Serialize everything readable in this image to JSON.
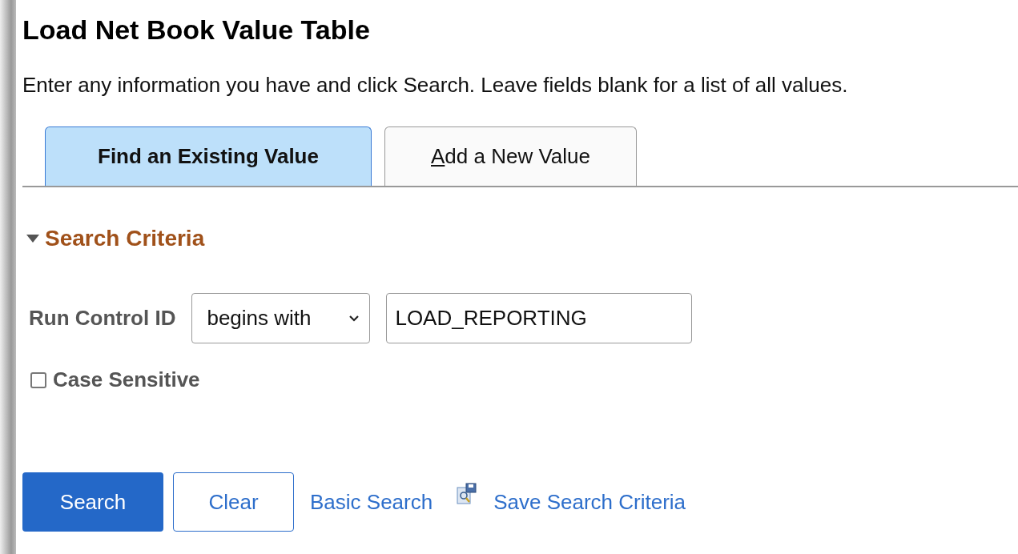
{
  "title": "Load Net Book Value Table",
  "instructions": "Enter any information you have and click Search. Leave fields blank for a list of all values.",
  "tabs": [
    {
      "label": "Find an Existing Value",
      "selected": true,
      "underline_first": false
    },
    {
      "label": "Add a New Value",
      "selected": false,
      "underline_first": true
    }
  ],
  "search_criteria": {
    "title": "Search Criteria",
    "expanded": true,
    "field_label": "Run Control ID",
    "operator": "begins with",
    "value": "LOAD_REPORTING",
    "case_sensitive": {
      "label": "Case Sensitive",
      "checked": false
    }
  },
  "buttons": [
    {
      "label": "Search",
      "kind": "primary"
    },
    {
      "label": "Clear",
      "kind": "secondary"
    }
  ],
  "links": [
    {
      "label": "Basic Search",
      "icon": false
    },
    {
      "label": "Save Search Criteria",
      "icon": true
    }
  ]
}
